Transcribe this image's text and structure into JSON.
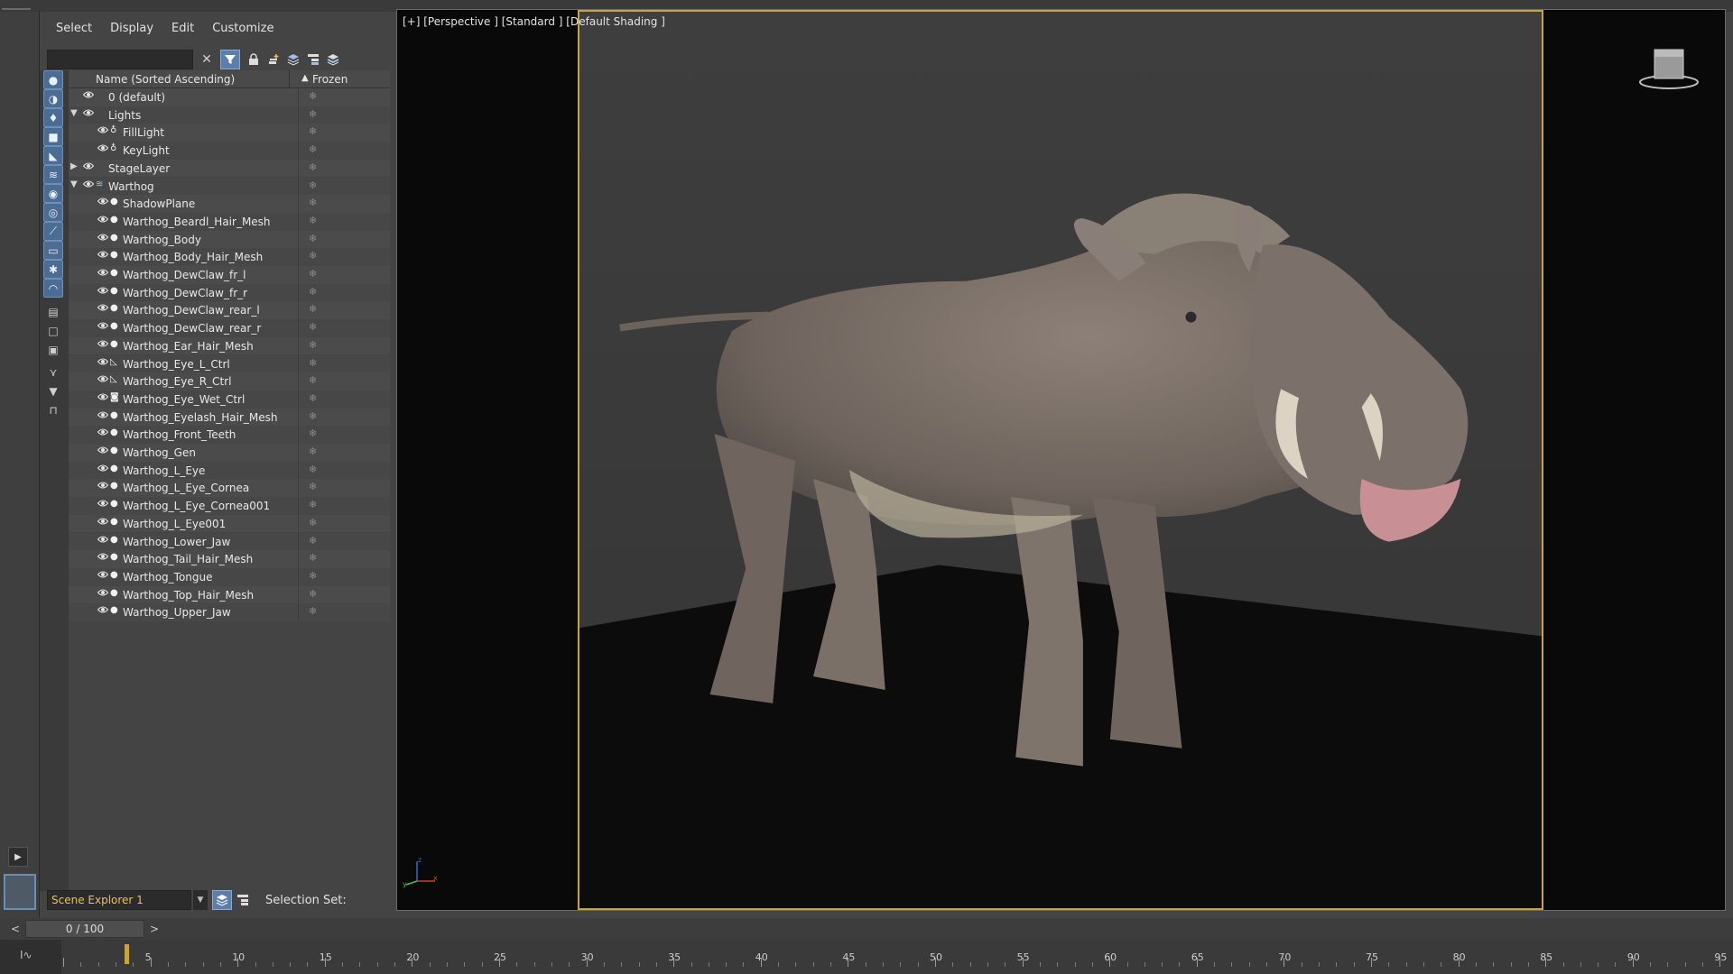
{
  "menu": {
    "items": [
      "Select",
      "Display",
      "Edit",
      "Customize"
    ]
  },
  "toolbar": {
    "search_value": "",
    "clear_icon": "close-icon",
    "filter_icon": "filter-icon"
  },
  "list": {
    "header_name": "Name (Sorted Ascending)",
    "header_frozen": "Frozen",
    "sort_arrow": "▲",
    "rows": [
      {
        "label": "0 (default)",
        "depth": 0,
        "expand": "",
        "icon": "layer"
      },
      {
        "label": "Lights",
        "depth": 0,
        "expand": "open",
        "icon": "layer"
      },
      {
        "label": "FillLight",
        "depth": 1,
        "expand": "",
        "icon": "light"
      },
      {
        "label": "KeyLight",
        "depth": 1,
        "expand": "",
        "icon": "light"
      },
      {
        "label": "StageLayer",
        "depth": 0,
        "expand": "closed",
        "icon": "layer"
      },
      {
        "label": "Warthog",
        "depth": 0,
        "expand": "open",
        "icon": "layer-active"
      },
      {
        "label": "ShadowPlane",
        "depth": 1,
        "expand": "",
        "icon": "object"
      },
      {
        "label": "Warthog_Beardl_Hair_Mesh",
        "depth": 1,
        "expand": "",
        "icon": "object"
      },
      {
        "label": "Warthog_Body",
        "depth": 1,
        "expand": "",
        "icon": "object"
      },
      {
        "label": "Warthog_Body_Hair_Mesh",
        "depth": 1,
        "expand": "",
        "icon": "object"
      },
      {
        "label": "Warthog_DewClaw_fr_l",
        "depth": 1,
        "expand": "",
        "icon": "object"
      },
      {
        "label": "Warthog_DewClaw_fr_r",
        "depth": 1,
        "expand": "",
        "icon": "object"
      },
      {
        "label": "Warthog_DewClaw_rear_l",
        "depth": 1,
        "expand": "",
        "icon": "object"
      },
      {
        "label": "Warthog_DewClaw_rear_r",
        "depth": 1,
        "expand": "",
        "icon": "object"
      },
      {
        "label": "Warthog_Ear_Hair_Mesh",
        "depth": 1,
        "expand": "",
        "icon": "object"
      },
      {
        "label": "Warthog_Eye_L_Ctrl",
        "depth": 1,
        "expand": "",
        "icon": "shape"
      },
      {
        "label": "Warthog_Eye_R_Ctrl",
        "depth": 1,
        "expand": "",
        "icon": "shape"
      },
      {
        "label": "Warthog_Eye_Wet_Ctrl",
        "depth": 1,
        "expand": "",
        "icon": "helper"
      },
      {
        "label": "Warthog_Eyelash_Hair_Mesh",
        "depth": 1,
        "expand": "",
        "icon": "object"
      },
      {
        "label": "Warthog_Front_Teeth",
        "depth": 1,
        "expand": "",
        "icon": "object"
      },
      {
        "label": "Warthog_Gen",
        "depth": 1,
        "expand": "",
        "icon": "object"
      },
      {
        "label": "Warthog_L_Eye",
        "depth": 1,
        "expand": "",
        "icon": "object"
      },
      {
        "label": "Warthog_L_Eye_Cornea",
        "depth": 1,
        "expand": "",
        "icon": "object"
      },
      {
        "label": "Warthog_L_Eye_Cornea001",
        "depth": 1,
        "expand": "",
        "icon": "object"
      },
      {
        "label": "Warthog_L_Eye001",
        "depth": 1,
        "expand": "",
        "icon": "object"
      },
      {
        "label": "Warthog_Lower_Jaw",
        "depth": 1,
        "expand": "",
        "icon": "object"
      },
      {
        "label": "Warthog_Tail_Hair_Mesh",
        "depth": 1,
        "expand": "",
        "icon": "object"
      },
      {
        "label": "Warthog_Tongue",
        "depth": 1,
        "expand": "",
        "icon": "object"
      },
      {
        "label": "Warthog_Top_Hair_Mesh",
        "depth": 1,
        "expand": "",
        "icon": "object"
      },
      {
        "label": "Warthog_Upper_Jaw",
        "depth": 1,
        "expand": "",
        "icon": "object"
      }
    ]
  },
  "explorer_bottom": {
    "explorer_name": "Scene Explorer 1",
    "selection_set_label": "Selection Set:"
  },
  "viewport": {
    "label": "[+] [Perspective ] [Standard ] [Default Shading ]",
    "axis_x": "x",
    "axis_y": "y",
    "axis_z": "z"
  },
  "timeline": {
    "frame_display": "0 / 100",
    "prev_icon": "<",
    "next_icon": ">",
    "ticks": [
      "5",
      "10",
      "15",
      "20",
      "25",
      "30",
      "35",
      "40",
      "45",
      "50",
      "55",
      "60",
      "65",
      "70",
      "75",
      "80",
      "85",
      "90",
      "95"
    ]
  },
  "colors": {
    "accent_blue": "#5c7ea8",
    "safe_frame": "#c7a53a",
    "explorer_name_text": "#e4c74a"
  }
}
